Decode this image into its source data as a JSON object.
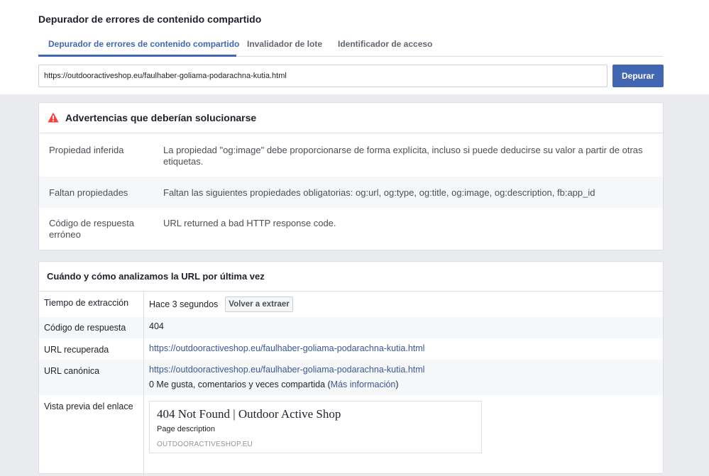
{
  "header": {
    "title": "Depurador de errores de contenido compartido"
  },
  "tabs": [
    {
      "label": "Depurador de errores de contenido compartido",
      "active": true
    },
    {
      "label": "Invalidador de lote",
      "active": false
    },
    {
      "label": "Identificador de acceso",
      "active": false
    }
  ],
  "search": {
    "url_value": "https://outdooractiveshop.eu/faulhaber-goliama-podarachna-kutia.html",
    "button_label": "Depurar"
  },
  "warnings": {
    "title": "Advertencias que deberían solucionarse",
    "icon": "warning-triangle-icon",
    "rows": [
      {
        "label": "Propiedad inferida",
        "value": "La propiedad \"og:image\" debe proporcionarse de forma explícita, incluso si puede deducirse su valor a partir de otras etiquetas."
      },
      {
        "label": "Faltan propiedades",
        "value": "Faltan las siguientes propiedades obligatorias: og:url, og:type, og:title, og:image, og:description, fb:app_id"
      },
      {
        "label": "Código de respuesta erróneo",
        "value": "URL returned a bad HTTP response code."
      }
    ]
  },
  "analysis": {
    "title": "Cuándo y cómo analizamos la URL por última vez",
    "fetch_time": {
      "label": "Tiempo de extracción",
      "value": "Hace 3 segundos",
      "button_label": "Volver a extraer"
    },
    "response_code": {
      "label": "Código de respuesta",
      "value": "404"
    },
    "fetched_url": {
      "label": "URL recuperada",
      "value": "https://outdooractiveshop.eu/faulhaber-goliama-podarachna-kutia.html"
    },
    "canonical_url": {
      "label": "URL canónica",
      "value": "https://outdooractiveshop.eu/faulhaber-goliama-podarachna-kutia.html",
      "stats_prefix": "0 Me gusta, comentarios y veces compartida (",
      "more_info_link": "Más información",
      "stats_suffix": ")"
    },
    "link_preview": {
      "label": "Vista previa del enlace",
      "title": "404 Not Found | Outdoor Active Shop",
      "description": "Page description",
      "domain": "OUTDOORACTIVESHOP.EU"
    }
  },
  "colors": {
    "accent": "#4267b2",
    "link": "#385898",
    "warning": "#fa3e3e",
    "background": "#e9ebee"
  }
}
